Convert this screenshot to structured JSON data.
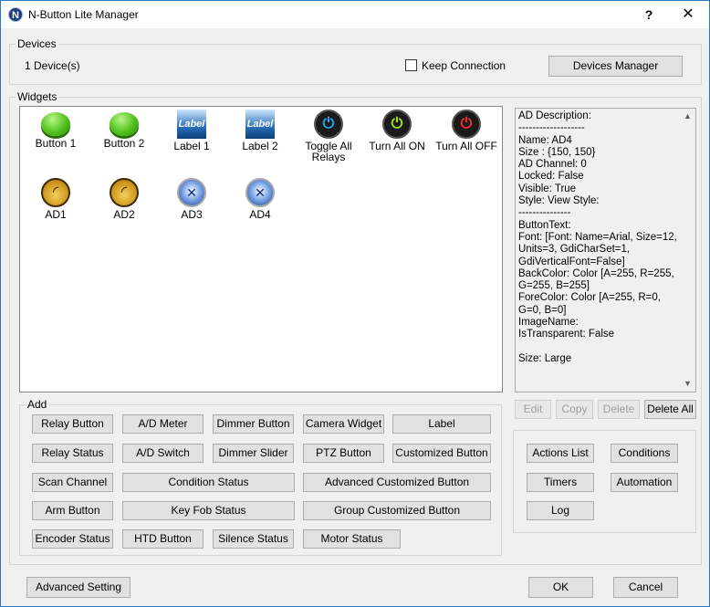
{
  "window": {
    "title": "N-Button Lite Manager",
    "icon_letter": "N",
    "help": "?",
    "close": "✕"
  },
  "devices": {
    "group_label": "Devices",
    "count": "1 Device(s)",
    "keep_connection": "Keep Connection",
    "keep_connection_checked": false,
    "manager_button": "Devices Manager"
  },
  "widgets": {
    "group_label": "Widgets",
    "items": [
      {
        "label": "Button 1",
        "icon": "green-button-icon"
      },
      {
        "label": "Button 2",
        "icon": "green-button-icon"
      },
      {
        "label": "Label 1",
        "icon": "label-image-icon",
        "icon_text": "Label"
      },
      {
        "label": "Label 2",
        "icon": "label-image-icon",
        "icon_text": "Label"
      },
      {
        "label": "Toggle All Relays",
        "icon": "power-blue-icon"
      },
      {
        "label": "Turn All ON",
        "icon": "power-green-icon"
      },
      {
        "label": "Turn All OFF",
        "icon": "power-red-icon"
      },
      {
        "label": "AD1",
        "icon": "gauge-gold-icon"
      },
      {
        "label": "AD2",
        "icon": "gauge-gold-icon"
      },
      {
        "label": "AD3",
        "icon": "clock-blue-icon"
      },
      {
        "label": "AD4",
        "icon": "clock-blue-icon"
      }
    ],
    "icon_colors": {
      "power_blue": "#1fa7ff",
      "power_green": "#a4e81a",
      "power_red": "#ff2b2b"
    }
  },
  "description": {
    "text": "AD Description:\n-------------------\nName: AD4\nSize : {150, 150}\nAD Channel: 0\nLocked: False\nVisible: True\nStyle: View Style:\n---------------\nButtonText:\nFont: [Font: Name=Arial, Size=12, Units=3, GdiCharSet=1, GdiVerticalFont=False]\nBackColor: Color [A=255, R=255, G=255, B=255]\nForeColor: Color [A=255, R=0, G=0, B=0]\nImageName:\nIsTransparent: False\n\nSize: Large"
  },
  "edit_buttons": {
    "edit": "Edit",
    "copy": "Copy",
    "delete": "Delete",
    "delete_all": "Delete All"
  },
  "add": {
    "group_label": "Add",
    "relay_button": "Relay Button",
    "ad_meter": "A/D Meter",
    "dimmer_button": "Dimmer Button",
    "camera_widget": "Camera Widget",
    "label": "Label",
    "relay_status": "Relay Status",
    "ad_switch": "A/D Switch",
    "dimmer_slider": "Dimmer Slider",
    "ptz_button": "PTZ Button",
    "customized_button": "Customized Button",
    "scan_channel": "Scan Channel",
    "condition_status": "Condition Status",
    "advanced_customized_button": "Advanced Customized Button",
    "arm_button": "Arm Button",
    "key_fob_status": "Key Fob Status",
    "group_customized_button": "Group Customized Button",
    "encoder_status": "Encoder Status",
    "htd_button": "HTD Button",
    "silence_status": "Silence Status",
    "motor_status": "Motor Status"
  },
  "side": {
    "actions_list": "Actions List",
    "conditions": "Conditions",
    "timers": "Timers",
    "automation": "Automation",
    "log": "Log"
  },
  "footer": {
    "advanced_setting": "Advanced Setting",
    "ok": "OK",
    "cancel": "Cancel"
  }
}
